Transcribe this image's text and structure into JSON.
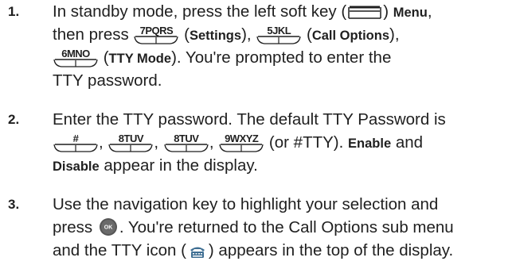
{
  "steps": [
    {
      "number": "1.",
      "t1": "In standby mode, press the left soft key (",
      "t2": ")",
      "menu": "Menu",
      "t3": ",",
      "t4": "then press",
      "key_7": "7PQRS",
      "t5": "(",
      "settings": "Settings",
      "t6": "),",
      "key_5": "5JKL",
      "t7": "(",
      "call_options": "Call Options",
      "t8": "),",
      "key_6": "6MNO",
      "t9": "(",
      "tty_mode": "TTY Mode",
      "t10": "). You're prompted to enter the",
      "t11": "TTY password."
    },
    {
      "number": "2.",
      "t1": "Enter the TTY password. The default TTY Password is",
      "key_hash": "#",
      "t2": ",",
      "key_8a": "8TUV",
      "t3": ",",
      "key_8b": "8TUV",
      "t4": ",",
      "key_9": "9WXYZ",
      "t5": "(or #TTY).",
      "enable": "Enable",
      "t6": "and",
      "disable": "Disable",
      "t7": "appear in the display."
    },
    {
      "number": "3.",
      "t1": "Use the navigation key to highlight your selection and",
      "t2": "press",
      "ok_label": "OK",
      "t3": ". You're returned to the Call Options sub menu",
      "t4": "and the TTY icon (",
      "t5": ") appears in the top of the display."
    }
  ],
  "icons": [
    "left-soft-key-icon",
    "ok-button-icon",
    "tty-icon"
  ],
  "colors": {
    "text": "#1f1f1f",
    "ok_button": "#555555",
    "tty_icon": "#3f6f93"
  }
}
